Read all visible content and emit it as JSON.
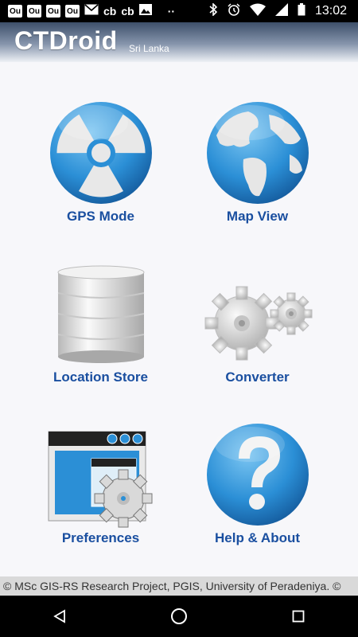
{
  "status_bar": {
    "notifications": [
      "Ou",
      "Ou",
      "Ou",
      "Ou",
      "mail",
      "cb",
      "cb",
      "image",
      "··"
    ],
    "time": "13:02"
  },
  "app": {
    "title": "CTDroid",
    "subtitle": "Sri Lanka"
  },
  "menu": [
    {
      "label": "GPS Mode",
      "icon": "radiation-icon"
    },
    {
      "label": "Map View",
      "icon": "globe-icon"
    },
    {
      "label": "Location Store",
      "icon": "database-icon"
    },
    {
      "label": "Converter",
      "icon": "gears-icon"
    },
    {
      "label": "Preferences",
      "icon": "settings-window-icon"
    },
    {
      "label": "Help & About",
      "icon": "help-icon"
    }
  ],
  "footer": {
    "text": "© MSc GIS-RS Research Project, PGIS, University of Peradeniya. ©"
  },
  "colors": {
    "accent_blue": "#1a4fa0",
    "icon_blue": "#2b8fd6"
  }
}
